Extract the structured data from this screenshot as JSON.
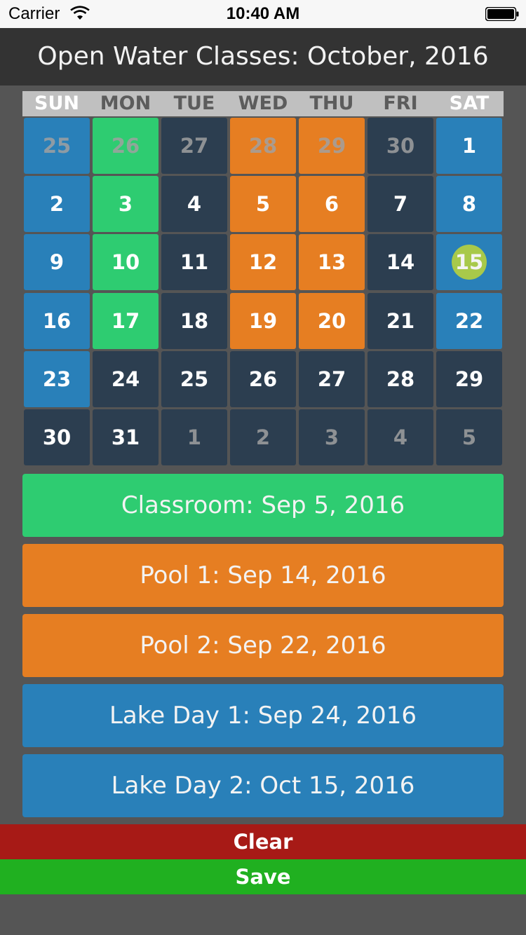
{
  "status_bar": {
    "carrier": "Carrier",
    "time": "10:40 AM",
    "wifi_icon": "wifi-icon",
    "battery_icon": "battery-icon"
  },
  "header": {
    "title": "Open Water Classes: October, 2016"
  },
  "calendar": {
    "weekdays": [
      "SUN",
      "MON",
      "TUE",
      "WED",
      "THU",
      "FRI",
      "SAT"
    ],
    "colors": {
      "dark": "#2c3e50",
      "blue": "#2980b9",
      "green": "#2ecc71",
      "orange": "#e67e22",
      "today": "#a8c94a"
    },
    "weeks": [
      [
        {
          "day": "25",
          "type": "blue",
          "dim": true
        },
        {
          "day": "26",
          "type": "green",
          "dim": true
        },
        {
          "day": "27",
          "type": "dark",
          "dim": true
        },
        {
          "day": "28",
          "type": "orange",
          "dim": true
        },
        {
          "day": "29",
          "type": "orange",
          "dim": true
        },
        {
          "day": "30",
          "type": "dark",
          "dim": true
        },
        {
          "day": "1",
          "type": "blue",
          "dim": false
        }
      ],
      [
        {
          "day": "2",
          "type": "blue",
          "dim": false
        },
        {
          "day": "3",
          "type": "green",
          "dim": false
        },
        {
          "day": "4",
          "type": "dark",
          "dim": false
        },
        {
          "day": "5",
          "type": "orange",
          "dim": false
        },
        {
          "day": "6",
          "type": "orange",
          "dim": false
        },
        {
          "day": "7",
          "type": "dark",
          "dim": false
        },
        {
          "day": "8",
          "type": "blue",
          "dim": false
        }
      ],
      [
        {
          "day": "9",
          "type": "blue",
          "dim": false
        },
        {
          "day": "10",
          "type": "green",
          "dim": false
        },
        {
          "day": "11",
          "type": "dark",
          "dim": false
        },
        {
          "day": "12",
          "type": "orange",
          "dim": false
        },
        {
          "day": "13",
          "type": "orange",
          "dim": false
        },
        {
          "day": "14",
          "type": "dark",
          "dim": false
        },
        {
          "day": "15",
          "type": "blue",
          "dim": false,
          "today": true
        }
      ],
      [
        {
          "day": "16",
          "type": "blue",
          "dim": false
        },
        {
          "day": "17",
          "type": "green",
          "dim": false
        },
        {
          "day": "18",
          "type": "dark",
          "dim": false
        },
        {
          "day": "19",
          "type": "orange",
          "dim": false
        },
        {
          "day": "20",
          "type": "orange",
          "dim": false
        },
        {
          "day": "21",
          "type": "dark",
          "dim": false
        },
        {
          "day": "22",
          "type": "blue",
          "dim": false
        }
      ],
      [
        {
          "day": "23",
          "type": "blue",
          "dim": false
        },
        {
          "day": "24",
          "type": "dark",
          "dim": false
        },
        {
          "day": "25",
          "type": "dark",
          "dim": false
        },
        {
          "day": "26",
          "type": "dark",
          "dim": false
        },
        {
          "day": "27",
          "type": "dark",
          "dim": false
        },
        {
          "day": "28",
          "type": "dark",
          "dim": false
        },
        {
          "day": "29",
          "type": "dark",
          "dim": false
        }
      ],
      [
        {
          "day": "30",
          "type": "dark",
          "dim": false
        },
        {
          "day": "31",
          "type": "dark",
          "dim": false
        },
        {
          "day": "1",
          "type": "dark",
          "dim": true
        },
        {
          "day": "2",
          "type": "dark",
          "dim": true
        },
        {
          "day": "3",
          "type": "dark",
          "dim": true
        },
        {
          "day": "4",
          "type": "dark",
          "dim": true
        },
        {
          "day": "5",
          "type": "dark",
          "dim": true
        }
      ]
    ]
  },
  "classes": [
    {
      "label": "Classroom: Sep 5, 2016",
      "color": "green"
    },
    {
      "label": "Pool 1: Sep 14, 2016",
      "color": "orange"
    },
    {
      "label": "Pool 2: Sep 22, 2016",
      "color": "orange"
    },
    {
      "label": "Lake Day 1: Sep 24, 2016",
      "color": "blue"
    },
    {
      "label": "Lake Day 2: Oct 15, 2016",
      "color": "blue"
    }
  ],
  "actions": {
    "clear_label": "Clear",
    "save_label": "Save",
    "clear_color": "#a71a16",
    "save_color": "#20b020"
  }
}
